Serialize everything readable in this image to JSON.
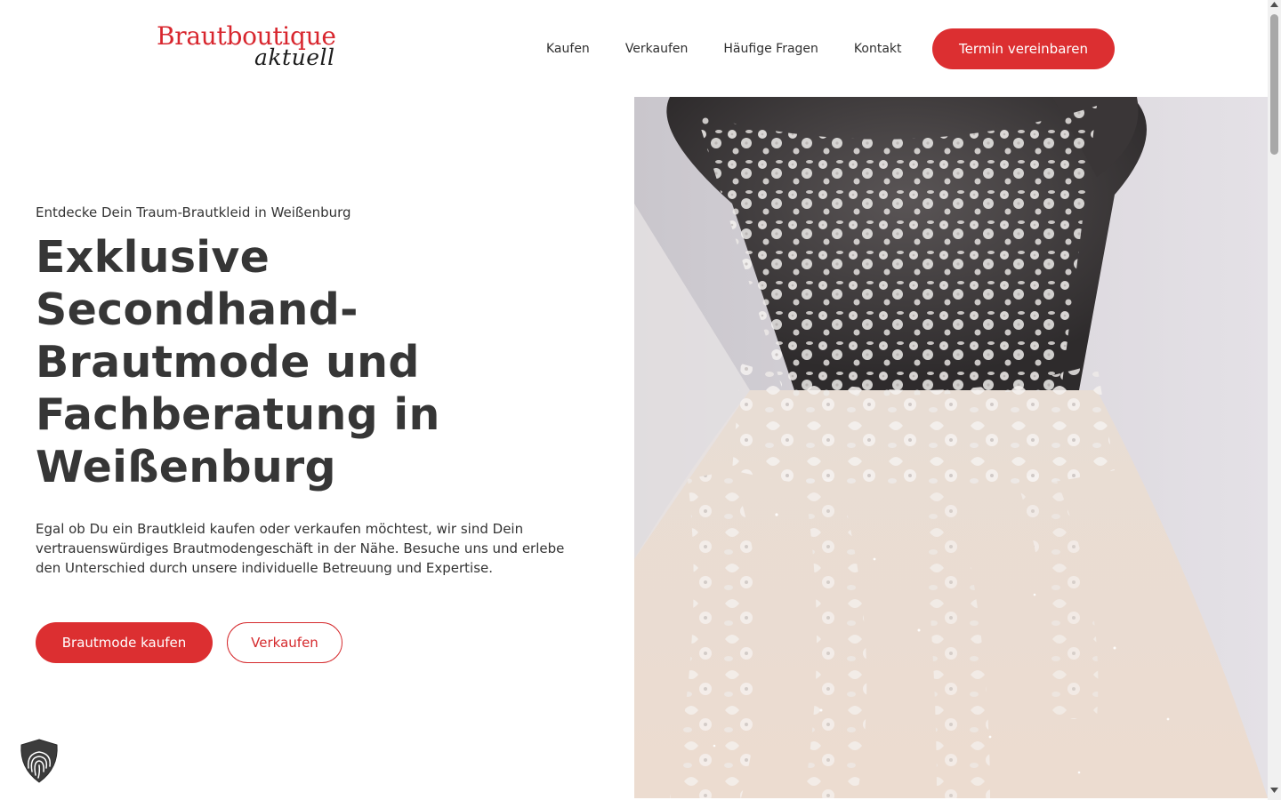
{
  "header": {
    "logo_line1": "Brautboutique",
    "logo_line2": "aktuell",
    "nav": [
      "Kaufen",
      "Verkaufen",
      "Häufige Fragen",
      "Kontakt"
    ],
    "cta_label": "Termin vereinbaren"
  },
  "hero": {
    "eyebrow": "Entdecke Dein Traum-Brautkleid in Weißenburg",
    "title": "Exklusive Secondhand-Brautmode und Fachberatung in Weißenburg",
    "description": "Egal ob Du ein Brautkleid kaufen oder verkaufen möchtest, wir sind Dein vertrauenswürdiges Brautmodengeschäft in der Nähe. Besuche uns und erlebe den Unterschied durch unsere individuelle Betreuung und Expertise.",
    "primary_button": "Brautmode kaufen",
    "secondary_button": "Verkaufen",
    "image_icon": "wedding-dress-photo"
  },
  "privacy_badge": {
    "icon": "fingerprint-shield-icon"
  },
  "colors": {
    "accent": "#dc2f31",
    "heading": "#363636",
    "text": "#333333",
    "background": "#ffffff"
  }
}
